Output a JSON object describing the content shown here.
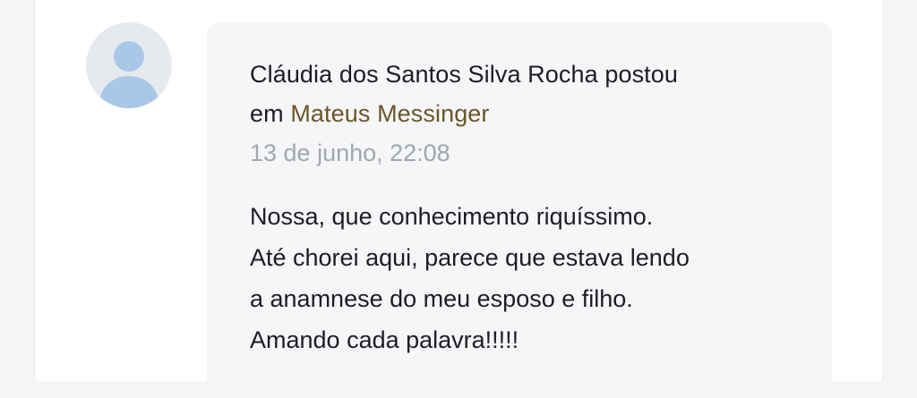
{
  "post": {
    "author": "Cláudia dos Santos Silva Rocha",
    "action": "postou",
    "preposition": "em",
    "target": "Mateus Messinger",
    "timestamp": "13 de junho, 22:08",
    "body_lines": [
      "Nossa, que conhecimento riquíssimo.",
      "Até chorei aqui, parece que estava lendo",
      "a anamnese do meu esposo e filho.",
      "Amando cada palavra!!!!!"
    ]
  },
  "icons": {
    "avatar": "default-user-avatar-icon"
  },
  "colors": {
    "target_link": "#6b5527",
    "timestamp": "#a2a6ad",
    "bubble_bg": "#f5f6f8",
    "avatar_bg": "#e6eaef",
    "avatar_figure": "#a9c8e8"
  }
}
